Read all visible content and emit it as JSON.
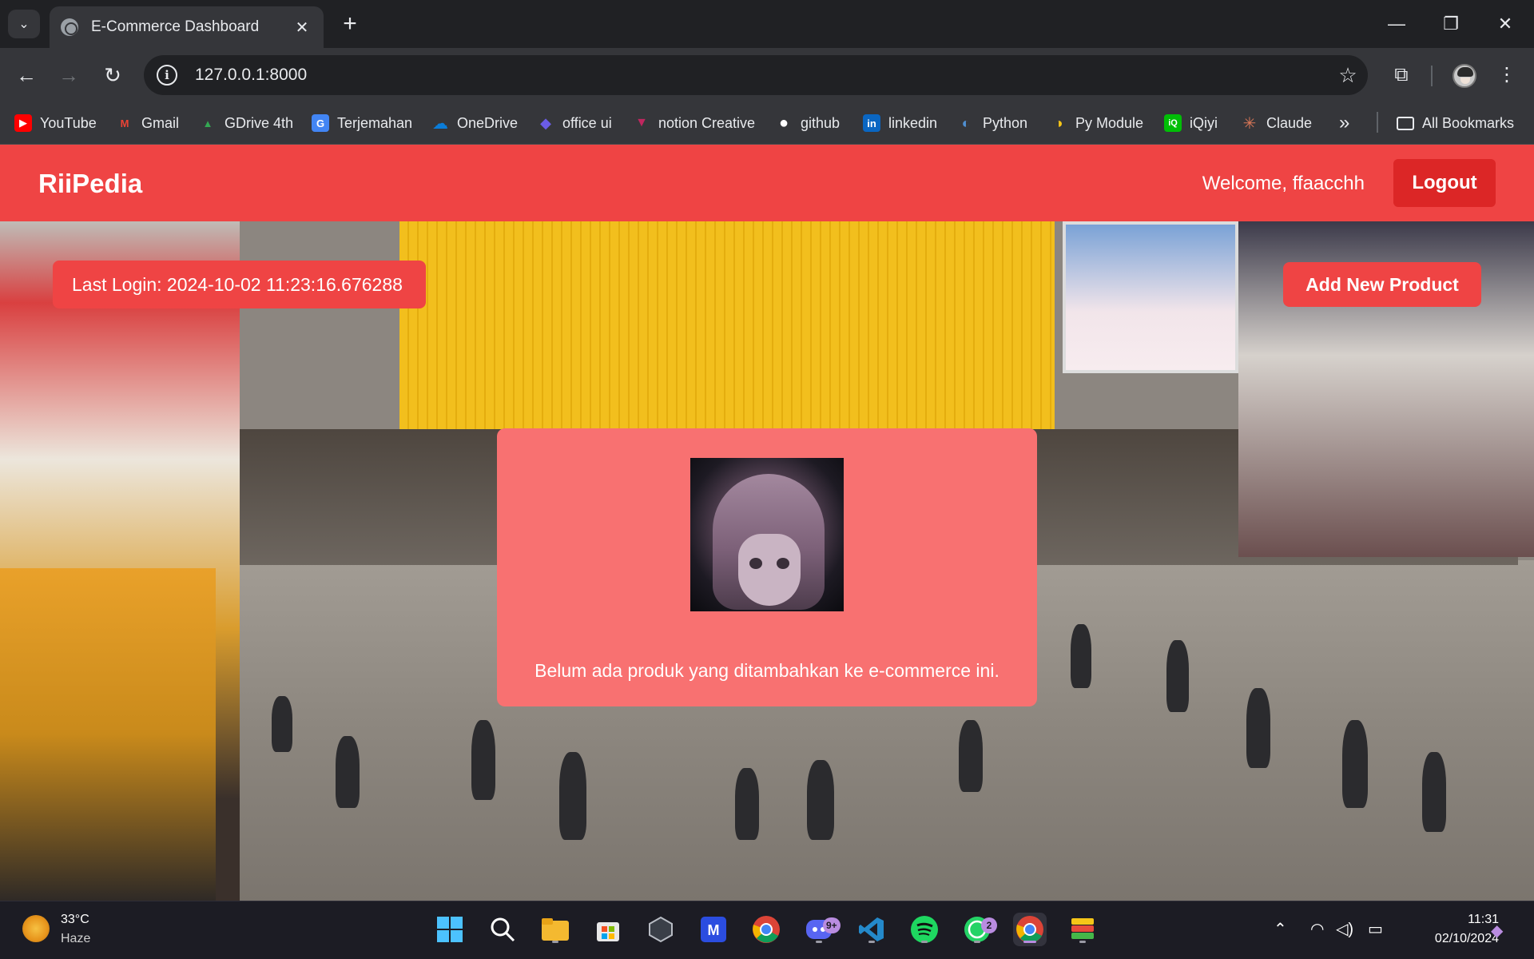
{
  "browser": {
    "tab_title": "E-Commerce Dashboard",
    "tab_close": "✕",
    "new_tab": "+",
    "url": "127.0.0.1:8000",
    "bookmarks": [
      {
        "label": "YouTube",
        "icon": "youtube-icon",
        "color": "#ff0000",
        "glyph": "▶"
      },
      {
        "label": "Gmail",
        "icon": "gmail-icon",
        "color": "#ea4335",
        "glyph": "M"
      },
      {
        "label": "GDrive 4th",
        "icon": "gdrive-icon",
        "color": "#34a853",
        "glyph": "▲"
      },
      {
        "label": "Terjemahan",
        "icon": "translate-icon",
        "color": "#4285f4",
        "glyph": "G"
      },
      {
        "label": "OneDrive",
        "icon": "onedrive-icon",
        "color": "#0a7cd8",
        "glyph": "☁"
      },
      {
        "label": "office ui",
        "icon": "office-icon",
        "color": "#6b5ce7",
        "glyph": "◆"
      },
      {
        "label": "notion Creative",
        "icon": "notion-icon",
        "color": "#c0265f",
        "glyph": "▼"
      },
      {
        "label": "github",
        "icon": "github-icon",
        "color": "#ffffff",
        "glyph": "●"
      },
      {
        "label": "linkedin",
        "icon": "linkedin-icon",
        "color": "#0a66c2",
        "glyph": "in"
      },
      {
        "label": "Python",
        "icon": "python-icon",
        "color": "#3776ab",
        "glyph": "◐"
      },
      {
        "label": "Py Module",
        "icon": "python-module-icon",
        "color": "#3776ab",
        "glyph": "◑"
      },
      {
        "label": "iQiyi",
        "icon": "iqiyi-icon",
        "color": "#00be06",
        "glyph": "iQ"
      },
      {
        "label": "Claude",
        "icon": "claude-icon",
        "color": "#d97757",
        "glyph": "✳"
      }
    ],
    "more_bookmarks": "»",
    "all_bookmarks": "All Bookmarks"
  },
  "navbar": {
    "brand": "RiiPedia",
    "welcome": "Welcome, ffaacchh",
    "logout_label": "Logout"
  },
  "dashboard": {
    "last_login": "Last Login: 2024-10-02 11:23:16.676288",
    "add_product_label": "Add New Product",
    "empty_message": "Belum ada produk yang ditambahkan ke e-commerce ini."
  },
  "colors": {
    "primary": "#ef4444",
    "button_dark": "#dc2626",
    "card": "#f87171"
  },
  "taskbar": {
    "temperature": "33°C",
    "weather": "Haze",
    "apps": [
      {
        "name": "windows-start-icon"
      },
      {
        "name": "search-icon"
      },
      {
        "name": "file-explorer-icon"
      },
      {
        "name": "microsoft-store-icon"
      },
      {
        "name": "unity-icon"
      },
      {
        "name": "ai-app-icon"
      },
      {
        "name": "chrome-icon"
      },
      {
        "name": "discord-icon",
        "badge": "9+"
      },
      {
        "name": "vscode-icon"
      },
      {
        "name": "spotify-icon"
      },
      {
        "name": "whatsapp-icon",
        "badge": "2"
      },
      {
        "name": "chrome-profile-icon"
      },
      {
        "name": "bluestacks-icon"
      }
    ],
    "time": "11:31",
    "date": "02/10/2024"
  }
}
